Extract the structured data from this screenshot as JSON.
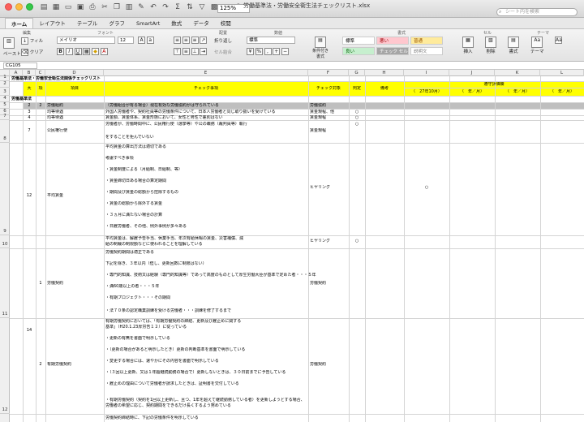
{
  "window": {
    "title": "労働基準法・労働安全衛生法チェックリスト.xlsx",
    "zoom": "125%",
    "search_placeholder": "シート内を検索"
  },
  "tabs": [
    "ホーム",
    "レイアウト",
    "テーブル",
    "グラフ",
    "SmartArt",
    "数式",
    "データ",
    "校閲"
  ],
  "ribbon": {
    "groups": [
      "編集",
      "フォント",
      "配置",
      "数値",
      "書式",
      "セル",
      "テーマ"
    ],
    "paste": "ペースト",
    "fill": "フィル",
    "clear": "クリア",
    "font_name": "メイリオ",
    "font_size": "12",
    "wrap": "折り返し",
    "merge": "セル結合",
    "number_format": "標準",
    "cond_format": "条件付き書式",
    "styles": [
      {
        "label": "標準",
        "bg": "#ffffff"
      },
      {
        "label": "悪い",
        "bg": "#ffc7ce"
      },
      {
        "label": "普通",
        "bg": "#ffeb9c"
      },
      {
        "label": "良い",
        "bg": "#c6efce"
      },
      {
        "label": "チェック セル",
        "bg": "#a5a5a5"
      },
      {
        "label": "説明文",
        "bg": "#ffffff"
      }
    ],
    "insert": "挿入",
    "delete": "削除",
    "format": "書式",
    "theme": "テーマ"
  },
  "namebox": "CG105",
  "columns": [
    "A",
    "B",
    "C",
    "D",
    "E",
    "F",
    "G",
    "H",
    "I",
    "J",
    "K",
    "L"
  ],
  "rows": [
    "1",
    "2",
    "3",
    "4",
    "5",
    "6",
    "7",
    "8",
    "9",
    "10",
    "11",
    "12"
  ],
  "sheet": {
    "title": "労働基準法・労働安全衛生法関係チェックリスト",
    "header": {
      "no": "大",
      "sub": "項",
      "item": "項目",
      "check": "チェック事項",
      "target": "チェック対象",
      "judge": "判定",
      "note": "備考",
      "result": "遵守評価欄",
      "date1": "（　27年10月）",
      "date2": "（　年／月）",
      "date3": "（　年／月）",
      "date4": "（　年／月）"
    },
    "section": "労働基準法",
    "r4": {
      "a": "2",
      "b": "2",
      "item": "労働組約",
      "check": "（労働組合が有る場合）現在有効な労働協約がは守られている",
      "target": "労働協約"
    },
    "r5": {
      "a": "3",
      "item": "均等待遇",
      "check": "外国人労働者や、契約社員等の労働条件について、日本人労働者と同じ取り扱いを受けている",
      "target": "賃金規程、他",
      "mark": "○"
    },
    "r6": {
      "a": "4",
      "item": "均等待遇",
      "check": "賃金額、賃金体系、賃金形態において、女性と男性で差別はない",
      "target": "賃金規程",
      "mark": "○"
    },
    "r7": {
      "a": "7",
      "item": "公民権行使",
      "check1": "労働者が、労働時間中に、公民権行使（選挙等）や公の職務（裁判員等）執行",
      "check2": "をすることを拒んでいない",
      "target": "賃金規程",
      "mark": "○"
    },
    "r8": {
      "a": "12",
      "item": "平均賃金",
      "lines": [
        "平均賃金の算出方法は適切である",
        "考慮すべき事項",
        "・賃金制度による（月給制、日給制、等）",
        "・賃金締切日ある場合の算定期間",
        "・期間及び賃金の総額から控除するもの",
        "・賃金の総額から除外する賃金",
        "・３ヵ月に満たない場合の計算",
        "・日雇労働者、その他、例外事例が多々ある"
      ],
      "target": "ヒヤリング",
      "mark": "○"
    },
    "r9": {
      "line1": "平均賃金は、解雇予告手当、休業手当、年次有給休暇の賃金、災害補償、減",
      "line2": "給の制裁の制限額などに使われることを理解している",
      "target": "ヒヤリング",
      "mark": "○"
    },
    "r10": {
      "b": "1",
      "item": "労働契約",
      "lines": [
        "労働契約期間は適正である",
        "下記を除き、３年以内（但し、更新回数に制限はない）",
        "・専門的知識、技術又は経験（専門的知識等）であって高度のものとして厚生労働大臣が基準で定めた者・・・５年",
        "・満60歳以上の者・・・５年",
        "・有期プロジェクト・・・その期間",
        "・法７０条の認定職業訓練を受ける労働者・・・訓練を修了するまで"
      ],
      "target": "労働契約"
    },
    "r11": {
      "a": "14",
      "b": "2",
      "item": "有期労働契約",
      "lines": [
        "有期労働契約においては、「有期労働契約の締結、更新及び雇止めに関する",
        "基準」（H20.1.23厚労告１２）に従っている",
        "・更新の有無を書面で明示している",
        "・（更新の場合があると明示したとき）更新の判断基準を書面で明示している",
        "・変更する場合には、速やかにその内容を書面で明示している",
        "・（３回以上更新、又は１年超継続勤務の場合で）更新しないときは、３０日前までに予告している",
        "・雇止めの理由について労働者が請求したときは、証明書を交付している",
        "・有期労働契約（契約を1回以上更新し、且つ、1年を超えて継続勤務している者）を更新しようとする場合、労働者の希望に応じ、契約期間をできるだけ長くするよう努めている"
      ],
      "target": "労働契約"
    },
    "r12": {
      "line1": "労働契約締結時に、下記の労働条件を明示している"
    }
  }
}
